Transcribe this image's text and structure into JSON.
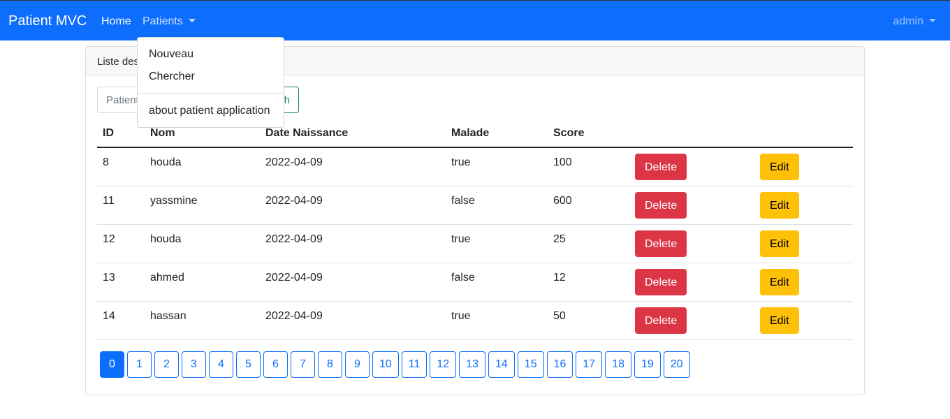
{
  "navbar": {
    "brand": "Patient MVC",
    "home": "Home",
    "patients": "Patients",
    "user": "admin",
    "color": "#0d6efd"
  },
  "dropdown": {
    "items": [
      "Nouveau",
      "Chercher"
    ],
    "footer_item": "about patient application"
  },
  "card": {
    "header": "Liste des"
  },
  "search": {
    "placeholder": "Patient",
    "button_label": "h"
  },
  "table": {
    "columns": [
      "ID",
      "Nom",
      "Date Naissance",
      "Malade",
      "Score"
    ],
    "rows": [
      {
        "id": "8",
        "nom": "houda",
        "date": "2022-04-09",
        "malade": "true",
        "score": "100"
      },
      {
        "id": "11",
        "nom": "yassmine",
        "date": "2022-04-09",
        "malade": "false",
        "score": "600"
      },
      {
        "id": "12",
        "nom": "houda",
        "date": "2022-04-09",
        "malade": "true",
        "score": "25"
      },
      {
        "id": "13",
        "nom": "ahmed",
        "date": "2022-04-09",
        "malade": "false",
        "score": "12"
      },
      {
        "id": "14",
        "nom": "hassan",
        "date": "2022-04-09",
        "malade": "true",
        "score": "50"
      }
    ],
    "delete_label": "Delete",
    "edit_label": "Edit"
  },
  "pagination": {
    "pages": [
      "0",
      "1",
      "2",
      "3",
      "4",
      "5",
      "6",
      "7",
      "8",
      "9",
      "10",
      "11",
      "12",
      "13",
      "14",
      "15",
      "16",
      "17",
      "18",
      "19",
      "20"
    ],
    "active": "0"
  },
  "colors": {
    "primary": "#0d6efd",
    "danger": "#dc3545",
    "warning": "#ffc107",
    "success": "#198754"
  }
}
